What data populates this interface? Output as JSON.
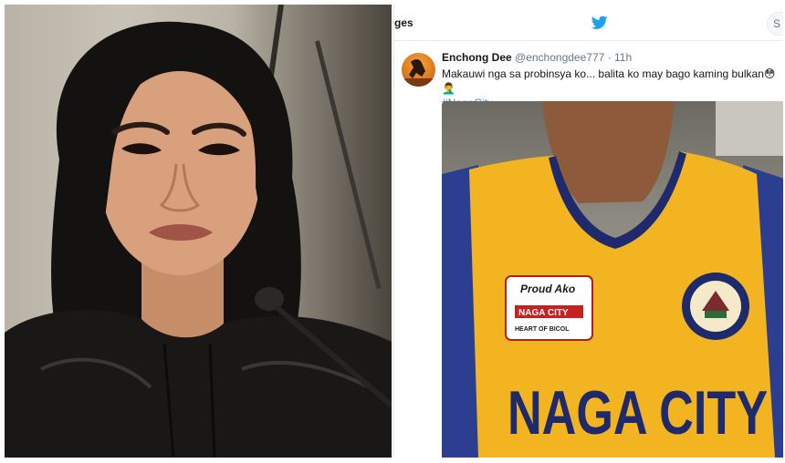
{
  "tweet_header": {
    "nav_partial": "ges",
    "twitter_icon": "twitter-bird-icon",
    "search_partial": "S"
  },
  "tweet": {
    "author_name": "Enchong Dee",
    "author_handle": "@enchongdee777",
    "separator": "·",
    "time": "11h",
    "text": "Makauwi nga sa probinsya ko... balita ko may bago kaming bulkan",
    "emojis": "😳🤦‍♂️",
    "hashtag": "#NagaCity",
    "avatar_icon": "avatar-image"
  },
  "media": {
    "patch_line1": "Proud Ako",
    "patch_line2": "NAGA CITY",
    "patch_line3": "HEART OF BICOL",
    "jersey_text": "NAGA CITY"
  },
  "colors": {
    "twitter_blue": "#1da1f2",
    "hashtag": "#1b95e0",
    "jersey_yellow": "#f2b521",
    "jersey_navy": "#1e2a6b"
  }
}
